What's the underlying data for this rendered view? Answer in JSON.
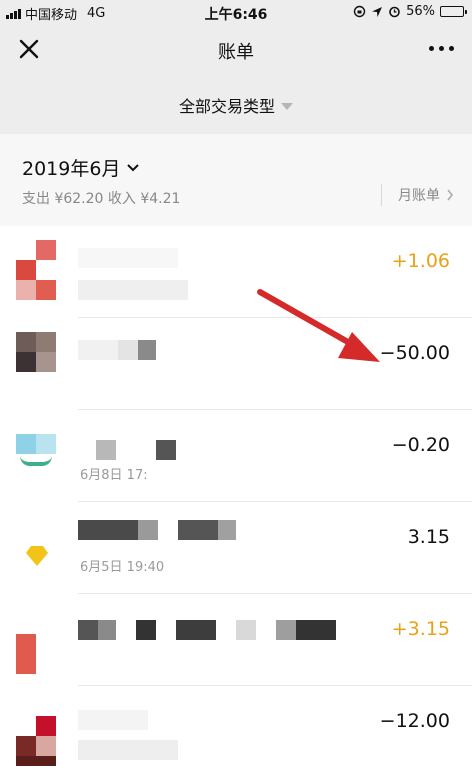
{
  "status_bar": {
    "carrier": "中国移动",
    "network": "4G",
    "time": "上午6:46",
    "battery": "56%",
    "battery_level": 0.56
  },
  "nav": {
    "title": "账单"
  },
  "filter": {
    "label": "全部交易类型"
  },
  "month": {
    "label": "2019年6月",
    "summary": "支出 ¥62.20 收入 ¥4.21",
    "monthly_bill_label": "月账单"
  },
  "transactions": [
    {
      "amount": "+1.06",
      "type": "income",
      "date": ""
    },
    {
      "amount": "−50.00",
      "type": "expense",
      "date": ""
    },
    {
      "amount": "−0.20",
      "type": "expense",
      "date": "6月8日 17:"
    },
    {
      "amount": "3.15",
      "type": "expense",
      "date": "6月5日 19:40"
    },
    {
      "amount": "+3.15",
      "type": "income",
      "date": ""
    },
    {
      "amount": "−12.00",
      "type": "expense",
      "date": ""
    }
  ],
  "colors": {
    "income": "#e8a21a",
    "annotation_arrow": "#d42a2a"
  }
}
